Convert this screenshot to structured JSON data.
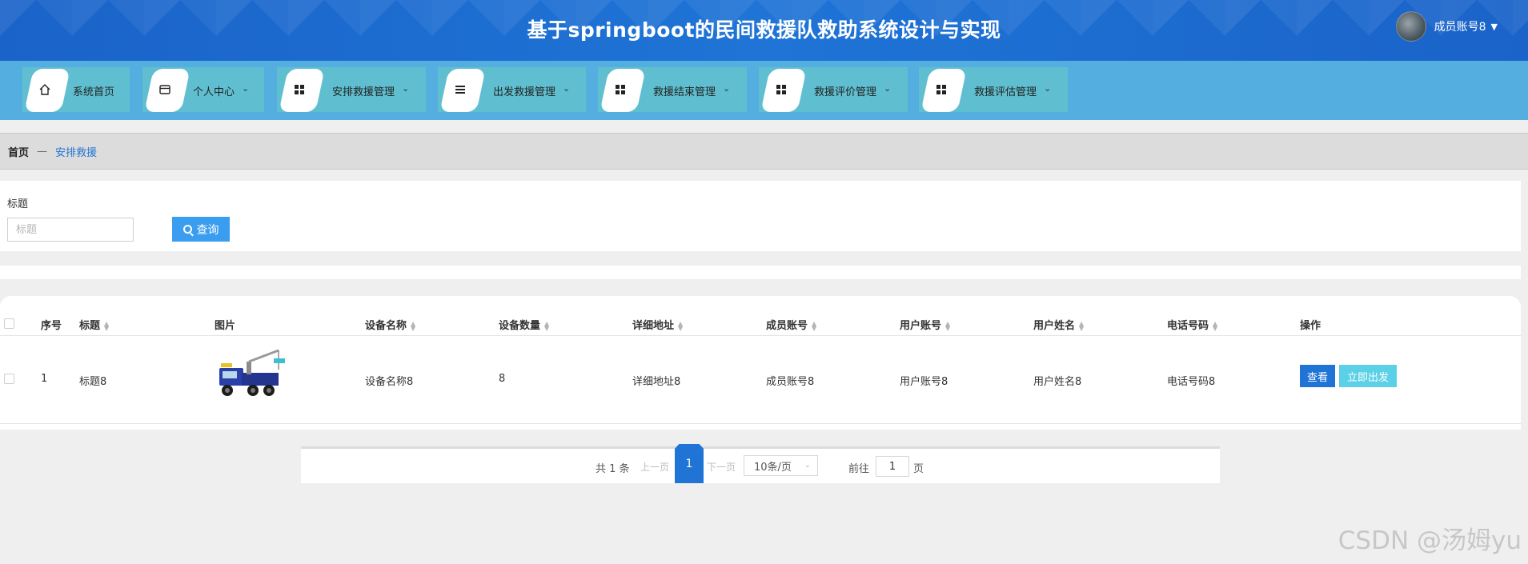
{
  "header": {
    "title": "基于springboot的民间救援队救助系统设计与实现",
    "user_name": "成员账号8",
    "user_caret": "▼"
  },
  "nav": [
    {
      "label": "系统首页",
      "icon": "home-icon",
      "has_dropdown": false
    },
    {
      "label": "个人中心",
      "icon": "wallet-icon",
      "has_dropdown": true
    },
    {
      "label": "安排救援管理",
      "icon": "grid-icon",
      "has_dropdown": true
    },
    {
      "label": "出发救援管理",
      "icon": "list-icon",
      "has_dropdown": true
    },
    {
      "label": "救援结束管理",
      "icon": "grid-icon",
      "has_dropdown": true
    },
    {
      "label": "救援评价管理",
      "icon": "grid-icon",
      "has_dropdown": true
    },
    {
      "label": "救援评估管理",
      "icon": "grid-icon",
      "has_dropdown": true
    }
  ],
  "breadcrumb": {
    "home": "首页",
    "separator": "—",
    "current": "安排救援"
  },
  "search": {
    "label": "标题",
    "placeholder": "标题",
    "value": "",
    "button": "查询"
  },
  "table": {
    "headers": {
      "index": "序号",
      "title": "标题",
      "image": "图片",
      "device_name": "设备名称",
      "device_count": "设备数量",
      "address": "详细地址",
      "member_account": "成员账号",
      "user_account": "用户账号",
      "user_name": "用户姓名",
      "phone": "电话号码",
      "actions": "操作"
    },
    "rows": [
      {
        "index": "1",
        "title": "标题8",
        "image": "tow-truck-image",
        "device_name": "设备名称8",
        "device_count": "8",
        "address": "详细地址8",
        "member_account": "成员账号8",
        "user_account": "用户账号8",
        "user_name": "用户姓名8",
        "phone": "电话号码8",
        "view_label": "查看",
        "go_label": "立即出发"
      }
    ]
  },
  "pagination": {
    "total": "共 1 条",
    "prev": "上一页",
    "current_page": "1",
    "next": "下一页",
    "page_size": "10条/页",
    "goto_label": "前往",
    "goto_value": "1",
    "goto_unit": "页"
  },
  "watermark": "CSDN @汤姆yu",
  "colors": {
    "header_blue": "#1f74d6",
    "nav_bg": "#55aee0",
    "nav_item_bg": "#5fbfd0",
    "primary": "#1f74d6",
    "search_button": "#3a9df0",
    "go_button": "#5bd0e6"
  }
}
